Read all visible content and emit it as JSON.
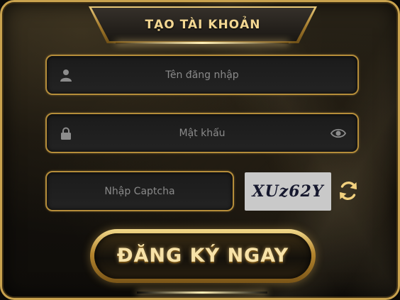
{
  "dialog": {
    "title": "TẠO TÀI KHOẢN"
  },
  "form": {
    "username": {
      "placeholder": "Tên đăng nhập",
      "value": "",
      "icon": "user-icon"
    },
    "password": {
      "placeholder": "Mật khẩu",
      "value": "",
      "icon": "lock-icon",
      "toggle_icon": "eye-icon"
    },
    "captcha": {
      "placeholder": "Nhập Captcha",
      "value": "",
      "code": "XUz62Y",
      "refresh_icon": "refresh-icon"
    }
  },
  "actions": {
    "register_label": "ĐĂNG KÝ NGAY"
  },
  "colors": {
    "gold": "#c9a24e",
    "gold_light": "#f3d792",
    "background": "#14110c",
    "field_bg": "#1f1f1f",
    "captcha_bg": "#c9c9c9"
  }
}
